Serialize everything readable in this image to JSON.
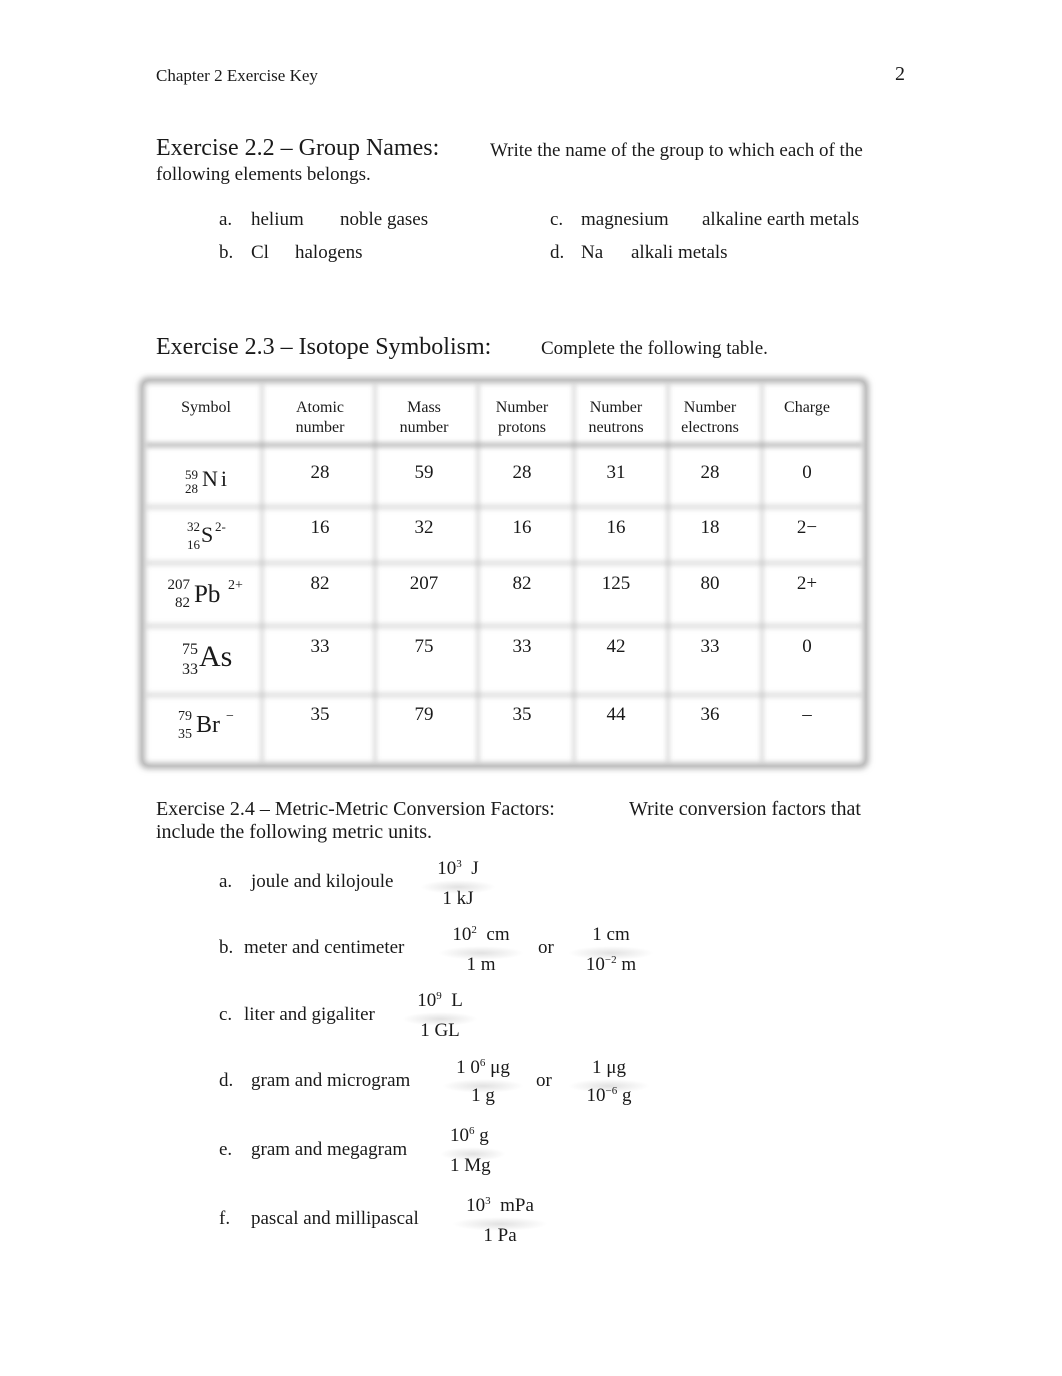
{
  "header": {
    "title": "Chapter 2 Exercise Key",
    "page_number": "2"
  },
  "ex22": {
    "title": "Exercise 2.2 – Group Names:",
    "instruction_line1": "Write the name of the group to which each of the",
    "instruction_line2": "following elements belongs.",
    "items": [
      {
        "letter": "a.",
        "element": "helium",
        "answer": "noble gases"
      },
      {
        "letter": "b.",
        "element": "Cl",
        "answer": "halogens"
      },
      {
        "letter": "c.",
        "element": "magnesium",
        "answer": "alkaline earth metals"
      },
      {
        "letter": "d.",
        "element": "Na",
        "answer": "alkali metals"
      }
    ]
  },
  "ex23": {
    "title": "Exercise 2.3 – Isotope Symbolism:",
    "instruction": "Complete the following table.",
    "headers": [
      {
        "l1": "Symbol",
        "l2": ""
      },
      {
        "l1": "Atomic",
        "l2": "number"
      },
      {
        "l1": "Mass",
        "l2": "number"
      },
      {
        "l1": "Number",
        "l2": "protons"
      },
      {
        "l1": "Number",
        "l2": "neutrons"
      },
      {
        "l1": "Number",
        "l2": "electrons"
      },
      {
        "l1": "Charge",
        "l2": ""
      }
    ],
    "rows": [
      {
        "mass": "59",
        "atomic": "28",
        "element": "Ni",
        "ion_charge": "",
        "cells": [
          "28",
          "59",
          "28",
          "31",
          "28",
          "0"
        ]
      },
      {
        "mass": "32",
        "atomic": "16",
        "element": "S",
        "ion_charge": "2-",
        "cells": [
          "16",
          "32",
          "16",
          "16",
          "18",
          "2−"
        ]
      },
      {
        "mass": "207",
        "atomic": "82",
        "element": "Pb",
        "ion_charge": "2+",
        "cells": [
          "82",
          "207",
          "82",
          "125",
          "80",
          "2+"
        ]
      },
      {
        "mass": "75",
        "atomic": "33",
        "element": "As",
        "ion_charge": "",
        "cells": [
          "33",
          "75",
          "33",
          "42",
          "33",
          "0"
        ]
      },
      {
        "mass": "79",
        "atomic": "35",
        "element": "Br",
        "ion_charge": "−",
        "cells": [
          "35",
          "79",
          "35",
          "44",
          "36",
          "–"
        ]
      }
    ]
  },
  "ex24": {
    "title": "Exercise 2.4 – Metric-Metric Conversion Factors:",
    "instruction_line1": "Write conversion factors that",
    "instruction_line2": "include the following metric units.",
    "or_label": "or",
    "items": [
      {
        "letter": "a.",
        "label": "joule and kilojoule",
        "f1": {
          "top_base": "10",
          "top_exp": "3",
          "top_unit": "J",
          "bottom": "1 kJ"
        }
      },
      {
        "letter": "b.",
        "label": "meter and centimeter",
        "f1": {
          "top_base": "10",
          "top_exp": "2",
          "top_unit": "cm",
          "bottom": "1 m"
        },
        "f2": {
          "top": "1 cm",
          "bottom_base": "10",
          "bottom_exp": "−2",
          "bottom_unit": "m"
        }
      },
      {
        "letter": "c.",
        "label": "liter and gigaliter",
        "f1": {
          "top_base": "10",
          "top_exp": "9",
          "top_unit": "L",
          "bottom": "1 GL"
        }
      },
      {
        "letter": "d.",
        "label": "gram and microgram",
        "f1": {
          "top_base": "1 0",
          "top_exp": "6",
          "top_unit": "μg",
          "bottom": "1 g"
        },
        "f2": {
          "top": "1 μg",
          "bottom_base": "10",
          "bottom_exp": "−6",
          "bottom_unit": "g"
        }
      },
      {
        "letter": "e.",
        "label": "gram and megagram",
        "f1": {
          "top_base": "10",
          "top_exp": "6",
          "top_unit": "g",
          "bottom": "1 Mg"
        }
      },
      {
        "letter": "f.",
        "label": "pascal and millipascal",
        "f1": {
          "top_base": "10",
          "top_exp": "3",
          "top_unit": "mPa",
          "bottom": "1 Pa"
        }
      }
    ]
  }
}
